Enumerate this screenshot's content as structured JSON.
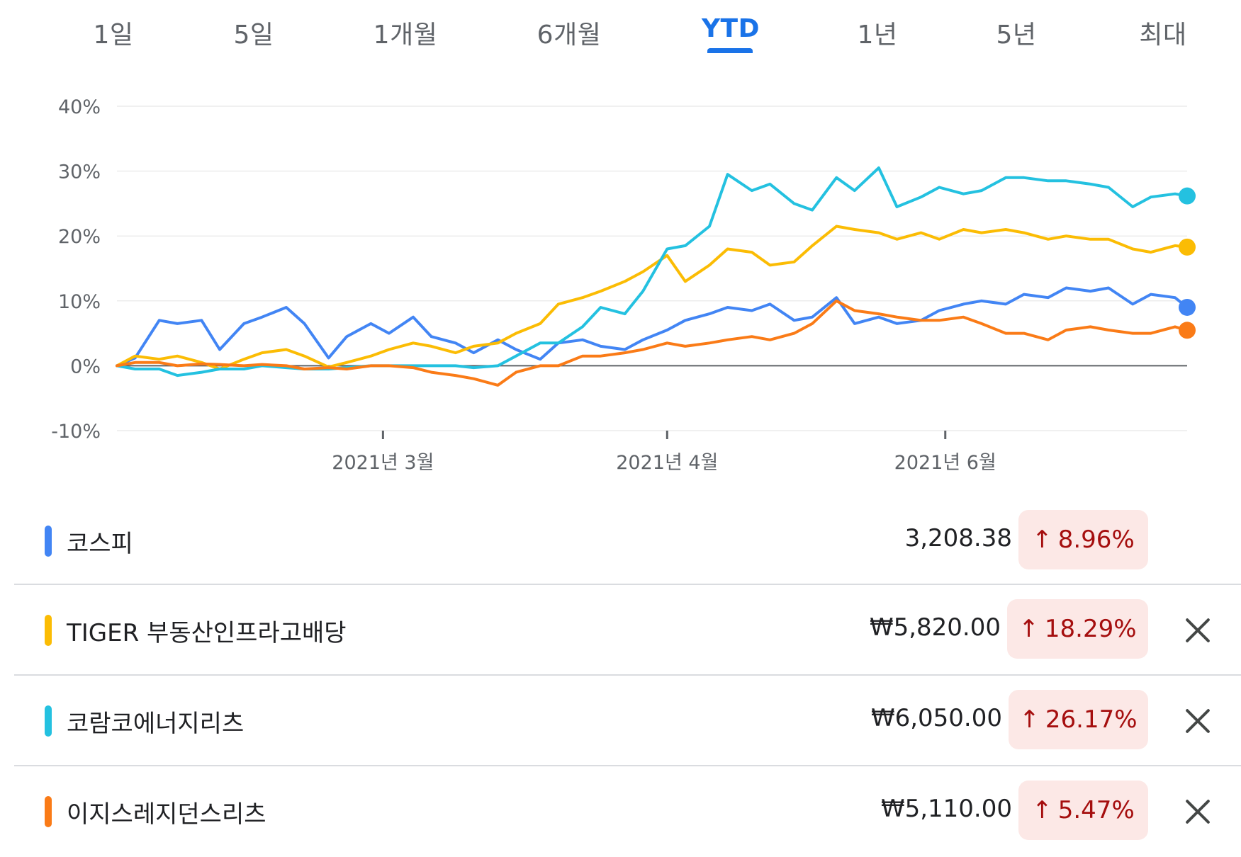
{
  "tabs": [
    {
      "label": "1일",
      "active": false
    },
    {
      "label": "5일",
      "active": false
    },
    {
      "label": "1개월",
      "active": false
    },
    {
      "label": "6개월",
      "active": false
    },
    {
      "label": "YTD",
      "active": true
    },
    {
      "label": "1년",
      "active": false
    },
    {
      "label": "5년",
      "active": false
    },
    {
      "label": "최대",
      "active": false
    }
  ],
  "colors": {
    "accent": "#1a73e8",
    "gain_badge_bg": "#fce8e6",
    "gain_text": "#a50e0e"
  },
  "chart_data": {
    "type": "line",
    "title": "",
    "xlabel": "",
    "ylabel": "",
    "ylim": [
      -10,
      40
    ],
    "y_ticks": [
      "40%",
      "30%",
      "20%",
      "10%",
      "0%",
      "-10%"
    ],
    "y_tick_values": [
      40,
      30,
      20,
      10,
      0,
      -10
    ],
    "x_domain": [
      "2021-01-04",
      "2021-06-30"
    ],
    "x_ticks": [
      {
        "date": "2021-02-17",
        "label": "2021년 3월"
      },
      {
        "date": "2021-04-05",
        "label": "2021년 4월"
      },
      {
        "date": "2021-05-21",
        "label": "2021년 6월"
      }
    ],
    "grid": true,
    "baseline": 0,
    "series": [
      {
        "name": "코스피",
        "color": "#4285f4",
        "points": [
          [
            "2021-01-04",
            0
          ],
          [
            "2021-01-07",
            1.2
          ],
          [
            "2021-01-11",
            7
          ],
          [
            "2021-01-14",
            6.5
          ],
          [
            "2021-01-18",
            7
          ],
          [
            "2021-01-21",
            2.5
          ],
          [
            "2021-01-25",
            6.5
          ],
          [
            "2021-01-28",
            7.5
          ],
          [
            "2021-02-01",
            9
          ],
          [
            "2021-02-04",
            6.5
          ],
          [
            "2021-02-08",
            1.2
          ],
          [
            "2021-02-11",
            4.5
          ],
          [
            "2021-02-15",
            6.5
          ],
          [
            "2021-02-18",
            5
          ],
          [
            "2021-02-22",
            7.5
          ],
          [
            "2021-02-25",
            4.5
          ],
          [
            "2021-03-01",
            3.5
          ],
          [
            "2021-03-04",
            2
          ],
          [
            "2021-03-08",
            4
          ],
          [
            "2021-03-11",
            2.5
          ],
          [
            "2021-03-15",
            1
          ],
          [
            "2021-03-18",
            3.5
          ],
          [
            "2021-03-22",
            4
          ],
          [
            "2021-03-25",
            3
          ],
          [
            "2021-03-29",
            2.5
          ],
          [
            "2021-04-01",
            4
          ],
          [
            "2021-04-05",
            5.5
          ],
          [
            "2021-04-08",
            7
          ],
          [
            "2021-04-12",
            8
          ],
          [
            "2021-04-15",
            9
          ],
          [
            "2021-04-19",
            8.5
          ],
          [
            "2021-04-22",
            9.5
          ],
          [
            "2021-04-26",
            7
          ],
          [
            "2021-04-29",
            7.5
          ],
          [
            "2021-05-03",
            10.5
          ],
          [
            "2021-05-06",
            6.5
          ],
          [
            "2021-05-10",
            7.5
          ],
          [
            "2021-05-13",
            6.5
          ],
          [
            "2021-05-17",
            7
          ],
          [
            "2021-05-20",
            8.5
          ],
          [
            "2021-05-24",
            9.5
          ],
          [
            "2021-05-27",
            10
          ],
          [
            "2021-05-31",
            9.5
          ],
          [
            "2021-06-03",
            11
          ],
          [
            "2021-06-07",
            10.5
          ],
          [
            "2021-06-10",
            12
          ],
          [
            "2021-06-14",
            11.5
          ],
          [
            "2021-06-17",
            12
          ],
          [
            "2021-06-21",
            9.5
          ],
          [
            "2021-06-24",
            11
          ],
          [
            "2021-06-28",
            10.5
          ],
          [
            "2021-06-30",
            9
          ]
        ]
      },
      {
        "name": "TIGER 부동산인프라고배당",
        "color": "#fbbc04",
        "points": [
          [
            "2021-01-04",
            0
          ],
          [
            "2021-01-07",
            1.5
          ],
          [
            "2021-01-11",
            1
          ],
          [
            "2021-01-14",
            1.5
          ],
          [
            "2021-01-18",
            0.5
          ],
          [
            "2021-01-21",
            -0.5
          ],
          [
            "2021-01-25",
            1
          ],
          [
            "2021-01-28",
            2
          ],
          [
            "2021-02-01",
            2.5
          ],
          [
            "2021-02-04",
            1.5
          ],
          [
            "2021-02-08",
            -0.2
          ],
          [
            "2021-02-11",
            0.5
          ],
          [
            "2021-02-15",
            1.5
          ],
          [
            "2021-02-18",
            2.5
          ],
          [
            "2021-02-22",
            3.5
          ],
          [
            "2021-02-25",
            3
          ],
          [
            "2021-03-01",
            2
          ],
          [
            "2021-03-04",
            3
          ],
          [
            "2021-03-08",
            3.5
          ],
          [
            "2021-03-11",
            5
          ],
          [
            "2021-03-15",
            6.5
          ],
          [
            "2021-03-18",
            9.5
          ],
          [
            "2021-03-22",
            10.5
          ],
          [
            "2021-03-25",
            11.5
          ],
          [
            "2021-03-29",
            13
          ],
          [
            "2021-04-01",
            14.5
          ],
          [
            "2021-04-05",
            17
          ],
          [
            "2021-04-08",
            13
          ],
          [
            "2021-04-12",
            15.5
          ],
          [
            "2021-04-15",
            18
          ],
          [
            "2021-04-19",
            17.5
          ],
          [
            "2021-04-22",
            15.5
          ],
          [
            "2021-04-26",
            16
          ],
          [
            "2021-04-29",
            18.5
          ],
          [
            "2021-05-03",
            21.5
          ],
          [
            "2021-05-06",
            21
          ],
          [
            "2021-05-10",
            20.5
          ],
          [
            "2021-05-13",
            19.5
          ],
          [
            "2021-05-17",
            20.5
          ],
          [
            "2021-05-20",
            19.5
          ],
          [
            "2021-05-24",
            21
          ],
          [
            "2021-05-27",
            20.5
          ],
          [
            "2021-05-31",
            21
          ],
          [
            "2021-06-03",
            20.5
          ],
          [
            "2021-06-07",
            19.5
          ],
          [
            "2021-06-10",
            20
          ],
          [
            "2021-06-14",
            19.5
          ],
          [
            "2021-06-17",
            19.5
          ],
          [
            "2021-06-21",
            18
          ],
          [
            "2021-06-24",
            17.5
          ],
          [
            "2021-06-28",
            18.5
          ],
          [
            "2021-06-30",
            18.29
          ]
        ]
      },
      {
        "name": "코람코에너지리츠",
        "color": "#24c1e0",
        "points": [
          [
            "2021-01-04",
            0
          ],
          [
            "2021-01-07",
            -0.5
          ],
          [
            "2021-01-11",
            -0.5
          ],
          [
            "2021-01-14",
            -1.5
          ],
          [
            "2021-01-18",
            -1
          ],
          [
            "2021-01-21",
            -0.5
          ],
          [
            "2021-01-25",
            -0.5
          ],
          [
            "2021-01-28",
            0
          ],
          [
            "2021-02-01",
            -0.3
          ],
          [
            "2021-02-04",
            -0.5
          ],
          [
            "2021-02-08",
            -0.5
          ],
          [
            "2021-02-11",
            -0.3
          ],
          [
            "2021-02-15",
            0
          ],
          [
            "2021-02-18",
            0
          ],
          [
            "2021-02-22",
            0
          ],
          [
            "2021-02-25",
            0
          ],
          [
            "2021-03-01",
            0
          ],
          [
            "2021-03-04",
            -0.3
          ],
          [
            "2021-03-08",
            0
          ],
          [
            "2021-03-11",
            1.5
          ],
          [
            "2021-03-15",
            3.5
          ],
          [
            "2021-03-18",
            3.5
          ],
          [
            "2021-03-22",
            6
          ],
          [
            "2021-03-25",
            9
          ],
          [
            "2021-03-29",
            8
          ],
          [
            "2021-04-01",
            11.5
          ],
          [
            "2021-04-05",
            18
          ],
          [
            "2021-04-08",
            18.5
          ],
          [
            "2021-04-12",
            21.5
          ],
          [
            "2021-04-15",
            29.5
          ],
          [
            "2021-04-19",
            27
          ],
          [
            "2021-04-22",
            28
          ],
          [
            "2021-04-26",
            25
          ],
          [
            "2021-04-29",
            24
          ],
          [
            "2021-05-03",
            29
          ],
          [
            "2021-05-06",
            27
          ],
          [
            "2021-05-10",
            30.5
          ],
          [
            "2021-05-13",
            24.5
          ],
          [
            "2021-05-17",
            26
          ],
          [
            "2021-05-20",
            27.5
          ],
          [
            "2021-05-24",
            26.5
          ],
          [
            "2021-05-27",
            27
          ],
          [
            "2021-05-31",
            29
          ],
          [
            "2021-06-03",
            29
          ],
          [
            "2021-06-07",
            28.5
          ],
          [
            "2021-06-10",
            28.5
          ],
          [
            "2021-06-14",
            28
          ],
          [
            "2021-06-17",
            27.5
          ],
          [
            "2021-06-21",
            24.5
          ],
          [
            "2021-06-24",
            26
          ],
          [
            "2021-06-28",
            26.5
          ],
          [
            "2021-06-30",
            26.17
          ]
        ]
      },
      {
        "name": "이지스레지던스리츠",
        "color": "#fa7b17",
        "points": [
          [
            "2021-01-04",
            0
          ],
          [
            "2021-01-07",
            0.5
          ],
          [
            "2021-01-11",
            0.5
          ],
          [
            "2021-01-14",
            0
          ],
          [
            "2021-01-18",
            0.3
          ],
          [
            "2021-01-21",
            0.2
          ],
          [
            "2021-01-25",
            0
          ],
          [
            "2021-01-28",
            0.2
          ],
          [
            "2021-02-01",
            0
          ],
          [
            "2021-02-04",
            -0.5
          ],
          [
            "2021-02-08",
            -0.3
          ],
          [
            "2021-02-11",
            -0.5
          ],
          [
            "2021-02-15",
            0
          ],
          [
            "2021-02-18",
            0
          ],
          [
            "2021-02-22",
            -0.3
          ],
          [
            "2021-02-25",
            -1
          ],
          [
            "2021-03-01",
            -1.5
          ],
          [
            "2021-03-04",
            -2
          ],
          [
            "2021-03-08",
            -3
          ],
          [
            "2021-03-11",
            -1
          ],
          [
            "2021-03-15",
            0
          ],
          [
            "2021-03-18",
            0
          ],
          [
            "2021-03-22",
            1.5
          ],
          [
            "2021-03-25",
            1.5
          ],
          [
            "2021-03-29",
            2
          ],
          [
            "2021-04-01",
            2.5
          ],
          [
            "2021-04-05",
            3.5
          ],
          [
            "2021-04-08",
            3
          ],
          [
            "2021-04-12",
            3.5
          ],
          [
            "2021-04-15",
            4
          ],
          [
            "2021-04-19",
            4.5
          ],
          [
            "2021-04-22",
            4
          ],
          [
            "2021-04-26",
            5
          ],
          [
            "2021-04-29",
            6.5
          ],
          [
            "2021-05-03",
            10
          ],
          [
            "2021-05-06",
            8.5
          ],
          [
            "2021-05-10",
            8
          ],
          [
            "2021-05-13",
            7.5
          ],
          [
            "2021-05-17",
            7
          ],
          [
            "2021-05-20",
            7
          ],
          [
            "2021-05-24",
            7.5
          ],
          [
            "2021-05-27",
            6.5
          ],
          [
            "2021-05-31",
            5
          ],
          [
            "2021-06-03",
            5
          ],
          [
            "2021-06-07",
            4
          ],
          [
            "2021-06-10",
            5.5
          ],
          [
            "2021-06-14",
            6
          ],
          [
            "2021-06-17",
            5.5
          ],
          [
            "2021-06-21",
            5
          ],
          [
            "2021-06-24",
            5
          ],
          [
            "2021-06-28",
            6
          ],
          [
            "2021-06-30",
            5.47
          ]
        ]
      }
    ]
  },
  "legend": [
    {
      "name": "코스피",
      "color": "#4285f4",
      "price": "3,208.38",
      "change": "8.96%",
      "arrow": "↑",
      "removable": false
    },
    {
      "name": "TIGER 부동산인프라고배당",
      "color": "#fbbc04",
      "price": "₩5,820.00",
      "change": "18.29%",
      "arrow": "↑",
      "removable": true
    },
    {
      "name": "코람코에너지리츠",
      "color": "#24c1e0",
      "price": "₩6,050.00",
      "change": "26.17%",
      "arrow": "↑",
      "removable": true
    },
    {
      "name": "이지스레지던스리츠",
      "color": "#fa7b17",
      "price": "₩5,110.00",
      "change": "5.47%",
      "arrow": "↑",
      "removable": true
    }
  ],
  "icons": {
    "remove": "close-icon",
    "gain": "arrow-up-icon"
  }
}
